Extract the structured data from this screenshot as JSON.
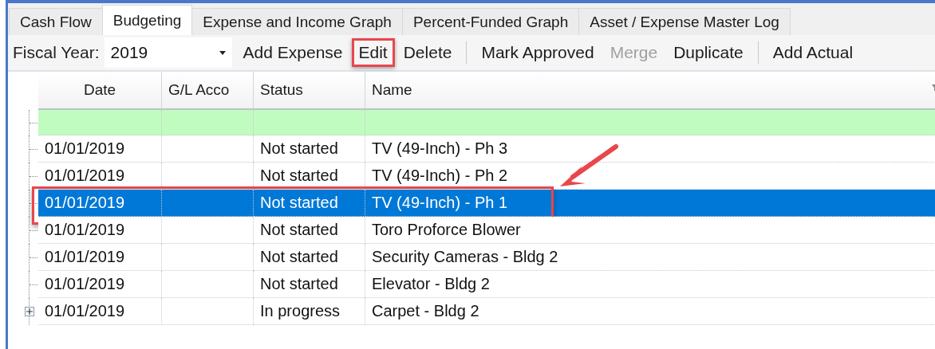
{
  "tabs": [
    {
      "label": "Cash Flow",
      "selected": false
    },
    {
      "label": "Budgeting",
      "selected": true
    },
    {
      "label": "Expense and Income Graph",
      "selected": false
    },
    {
      "label": "Percent-Funded Graph",
      "selected": false
    },
    {
      "label": "Asset / Expense Master Log",
      "selected": false
    }
  ],
  "toolbar": [
    {
      "kind": "label",
      "text": "Fiscal Year:"
    },
    {
      "kind": "dropdown",
      "text": "2019"
    },
    {
      "kind": "button",
      "text": "Add Expense",
      "disabled": false,
      "highlighted": false
    },
    {
      "kind": "button",
      "text": "Edit",
      "disabled": false,
      "highlighted": true
    },
    {
      "kind": "button",
      "text": "Delete",
      "disabled": false,
      "highlighted": false
    },
    {
      "kind": "separator"
    },
    {
      "kind": "button",
      "text": "Mark Approved",
      "disabled": false,
      "highlighted": false
    },
    {
      "kind": "button",
      "text": "Merge",
      "disabled": true,
      "highlighted": false
    },
    {
      "kind": "button",
      "text": "Duplicate",
      "disabled": false,
      "highlighted": false
    },
    {
      "kind": "separator"
    },
    {
      "kind": "button",
      "text": "Add Actual",
      "disabled": false,
      "highlighted": false
    }
  ],
  "table": {
    "columns": [
      "Date",
      "G/L Acco",
      "Status",
      "Name"
    ],
    "rows": [
      {
        "cells": [
          "01/01/2019",
          "",
          "Not started",
          "TV (49-Inch) - Ph 3"
        ],
        "selected": false,
        "highlighted": false,
        "expandable": false
      },
      {
        "cells": [
          "01/01/2019",
          "",
          "Not started",
          "TV (49-Inch) - Ph 2"
        ],
        "selected": false,
        "highlighted": false,
        "expandable": false
      },
      {
        "cells": [
          "01/01/2019",
          "",
          "Not started",
          "TV (49-Inch) - Ph 1"
        ],
        "selected": true,
        "highlighted": true,
        "expandable": false
      },
      {
        "cells": [
          "01/01/2019",
          "",
          "Not started",
          "Toro Proforce Blower"
        ],
        "selected": false,
        "highlighted": false,
        "expandable": false
      },
      {
        "cells": [
          "01/01/2019",
          "",
          "Not started",
          "Security Cameras - Bldg 2"
        ],
        "selected": false,
        "highlighted": false,
        "expandable": false
      },
      {
        "cells": [
          "01/01/2019",
          "",
          "Not started",
          "Elevator - Bldg 2"
        ],
        "selected": false,
        "highlighted": false,
        "expandable": false
      },
      {
        "cells": [
          "01/01/2019",
          "",
          "In progress",
          "Carpet - Bldg 2"
        ],
        "selected": false,
        "highlighted": false,
        "expandable": true
      }
    ]
  }
}
